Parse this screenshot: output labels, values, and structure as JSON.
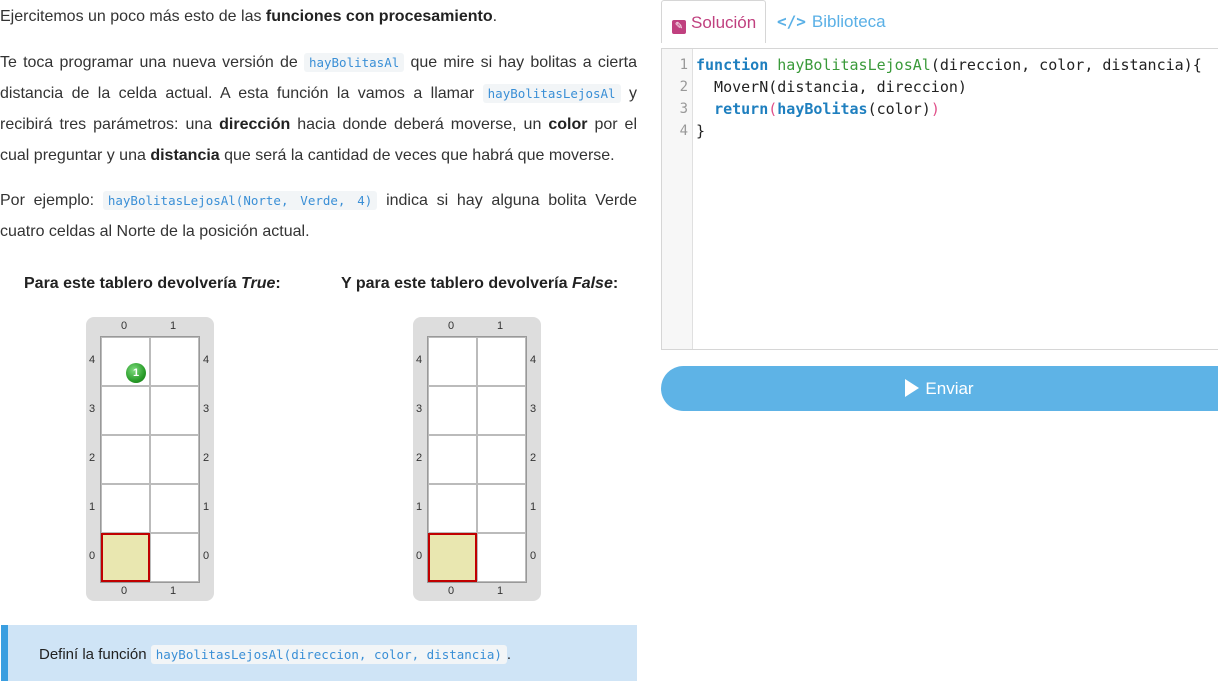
{
  "intro": {
    "text": "Ejercitemos un poco más esto de las ",
    "bold": "funciones con procesamiento",
    "end": "."
  },
  "p2": {
    "t1": "Te toca programar una nueva versión de ",
    "code1": "hayBolitasAl",
    "t2": " que mire si hay bolitas a cierta distancia de la celda actual. A esta función la vamos a llamar ",
    "code2": "hayBolitasLejosAl",
    "t3": " y recibirá tres parámetros: una ",
    "b1": "dirección",
    "t4": " hacia donde deberá moverse, un ",
    "b2": "color",
    "t5": " por el cual preguntar y una ",
    "b3": "distancia",
    "t6": " que será la cantidad de veces que habrá que moverse."
  },
  "p3": {
    "t1": "Por ejemplo: ",
    "code": "hayBolitasLejosAl(Norte, Verde, 4)",
    "t2": " indica si hay alguna bolita Verde cuatro celdas al Norte de la posición actual."
  },
  "boards": {
    "left_title_pre": "Para este tablero devolvería ",
    "left_title_em": "True",
    "left_title_post": ":",
    "right_title_pre": "Y para este tablero devolvería ",
    "right_title_em": "False",
    "right_title_post": ":",
    "col_labels": [
      "0",
      "1"
    ],
    "row_labels": [
      "4",
      "3",
      "2",
      "1",
      "0"
    ],
    "ball_count": "1",
    "ball_color": "#2a9d2a"
  },
  "alert": {
    "t1": "Definí la función ",
    "code": "hayBolitasLejosAl(direccion, color, distancia)",
    "t2": "."
  },
  "tabs": {
    "solution": "Solución",
    "library": "Biblioteca"
  },
  "editor": {
    "line_numbers": [
      "1",
      "2",
      "3",
      "4"
    ],
    "l1_kw": "function",
    "l1_fn": "hayBolitasLejosAl",
    "l1_rest": "(direccion, color, distancia){",
    "l2": "  MoverN(distancia, direccion)",
    "l3_kw": "return",
    "l3_open": "(",
    "l3_call": "hayBolitas",
    "l3_args": "(color)",
    "l3_close": ")",
    "l4": "}"
  },
  "send_button": "Enviar",
  "colors": {
    "accent_blue": "#5eb3e6",
    "solution_pink": "#c0407f",
    "head_border": "#c00000"
  }
}
